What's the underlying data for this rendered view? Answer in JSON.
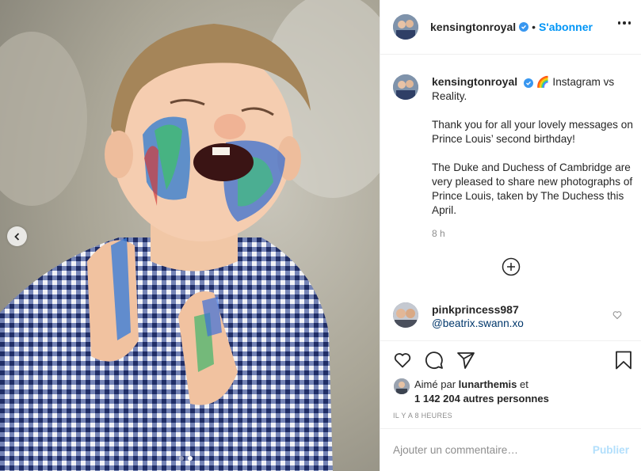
{
  "post": {
    "username": "kensingtonroyal",
    "separator": "•",
    "follow_label": "S'abonner",
    "more_icon": "more-horizontal-icon",
    "verified_icon": "verified-badge-icon"
  },
  "caption": {
    "username": "kensingtonroyal",
    "emoji": "🌈",
    "line1": "Instagram vs Reality.",
    "para2": "Thank you for all your lovely messages on Prince Louis’ second birthday!",
    "para3": "The Duke and Duchess of Cambridge are very pleased to share new photographs of Prince Louis, taken by The Duchess this April.",
    "time": "8 h"
  },
  "comments": [
    {
      "username": "pinkprincess987",
      "text": "@beatrix.swann.xo"
    }
  ],
  "actions": {
    "icons": [
      "heart-icon",
      "comment-icon",
      "share-icon",
      "bookmark-icon"
    ]
  },
  "likes": {
    "prefix": "Aimé par",
    "user": "lunarthemis",
    "joiner": "et",
    "others": "1 142 204 autres personnes"
  },
  "timestamp": "IL Y A 8 HEURES",
  "comment_box": {
    "placeholder": "Ajouter un commentaire…",
    "post_label": "Publier"
  },
  "carousel": {
    "current": 2,
    "total": 2
  },
  "colors": {
    "accent": "#0095f6",
    "verified": "#3897f0",
    "post_disabled": "#b2dffc"
  }
}
